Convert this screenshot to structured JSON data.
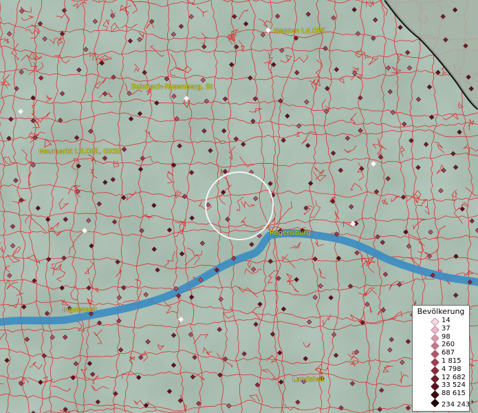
{
  "map": {
    "terrain_color": "#9fb4a6",
    "boundary_color": "#e02020",
    "river_color": "#3d8fc4",
    "marker_color": "#8a2a3a",
    "places": [
      {
        "name": "Weiden i.d.OPf.",
        "kind": "city"
      },
      {
        "name": "Sulzbach-Rosenberg, St",
        "kind": "city"
      },
      {
        "name": "Neumarkt i.d.OPf., GKSt",
        "kind": "city"
      },
      {
        "name": "Regensburg",
        "kind": "city"
      },
      {
        "name": "Ingolstadt",
        "kind": "city"
      },
      {
        "name": "Landshut",
        "kind": "city"
      }
    ]
  },
  "legend": {
    "title": "Bevölkerung",
    "classes": [
      {
        "label": "14",
        "color": "#f4dde6"
      },
      {
        "label": "37",
        "color": "#e8bccb"
      },
      {
        "label": "98",
        "color": "#d49aaa"
      },
      {
        "label": "260",
        "color": "#c07888"
      },
      {
        "label": "687",
        "color": "#ad5a6a"
      },
      {
        "label": "1 815",
        "color": "#9a4152"
      },
      {
        "label": "4 798",
        "color": "#862d3d"
      },
      {
        "label": "12 682",
        "color": "#6f1f2d"
      },
      {
        "label": "33 524",
        "color": "#561420"
      },
      {
        "label": "88 615",
        "color": "#3d0a14"
      },
      {
        "label": "234 243",
        "color": "#1e0308",
        "suffix": "+"
      }
    ]
  }
}
